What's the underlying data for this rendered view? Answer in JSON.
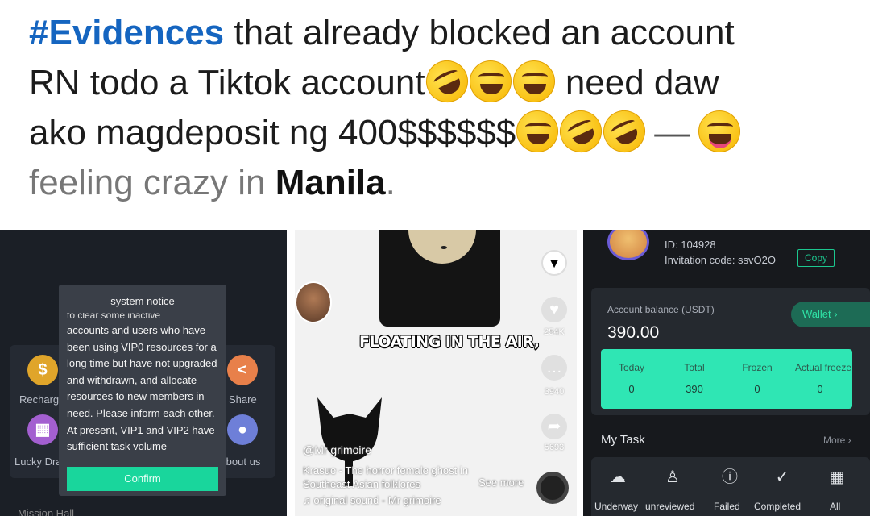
{
  "post": {
    "hashtag": "#Evidences",
    "line1_rest": " that already blocked an account",
    "line2a": "RN todo a Tiktok account",
    "line2b": " need daw",
    "line3": "ako magdeposit ng 400$$$$$$",
    "dash": "—",
    "feeling": "feeling crazy in ",
    "place": "Manila",
    "period": "."
  },
  "panel1": {
    "notice_title": "system notice",
    "notice_cut": "to clear some inactive",
    "notice_body": "accounts and users who have been using VIP0 resources for a long time but have not upgraded and withdrawn, and allocate resources to new members in need. Please inform each other. At present, VIP1 and VIP2 have sufficient task volume",
    "confirm": "Confirm",
    "labels": {
      "recharge": "Recharge",
      "share": "Share",
      "lucky": "Lucky Draw",
      "about": "About us"
    },
    "bottom_cut": "Mission Hall"
  },
  "panel2": {
    "overlay_text": "FLOATING IN THE AIR,",
    "likes": "254K",
    "comments": "3940",
    "shares": "5693",
    "username": "@Mr grimoire",
    "caption": "Krasue - The horror female ghost in Southeast Asian folklores",
    "see_more": "See more",
    "sound": "♫ original sound - Mr grimoire"
  },
  "panel3": {
    "id": "ID: 104928",
    "invitation": "Invitation code: ssvO2O",
    "copy": "Copy",
    "balance_label": "Account balance (USDT)",
    "balance": "390.00",
    "wallet": "Wallet ›",
    "stats": [
      {
        "label": "Today",
        "value": "0"
      },
      {
        "label": "Total",
        "value": "390"
      },
      {
        "label": "Frozen",
        "value": "0"
      },
      {
        "label": "Actual freeze",
        "value": "0"
      }
    ],
    "my_task": "My Task",
    "more": "More ›",
    "tasks": [
      "Underway",
      "unreviewed",
      "Failed",
      "Completed",
      "All"
    ]
  },
  "colors": {
    "hashtag": "#1565c0",
    "accent_green": "#2fe6b4",
    "confirm_green": "#19d69c"
  }
}
